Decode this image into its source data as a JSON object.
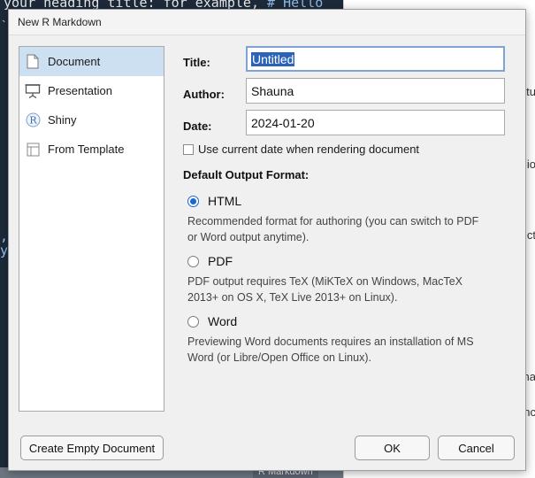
{
  "background": {
    "code_text": "your heading title: for example,",
    "code_comment": "# Hello",
    "frag_comma": ",",
    "frag_y": "y",
    "right_fragments": [
      "tu",
      "io",
      "ct",
      "na",
      "nc"
    ],
    "bottom_tab": "R Markdown"
  },
  "dialog": {
    "title": "New R Markdown",
    "sidebar": {
      "items": [
        {
          "label": "Document",
          "icon": "document-icon"
        },
        {
          "label": "Presentation",
          "icon": "presentation-icon"
        },
        {
          "label": "Shiny",
          "icon": "shiny-icon"
        },
        {
          "label": "From Template",
          "icon": "template-icon"
        }
      ],
      "selected_index": 0
    },
    "form": {
      "title_label": "Title:",
      "title_value": "Untitled",
      "author_label": "Author:",
      "author_value": "Shauna",
      "date_label": "Date:",
      "date_value": "2024-01-20",
      "use_current_date_label": "Use current date when rendering document",
      "use_current_date_checked": false
    },
    "output": {
      "heading": "Default Output Format:",
      "options": [
        {
          "label": "HTML",
          "checked": true,
          "desc1": "Recommended format for authoring (you can switch to PDF",
          "desc2": "or Word output anytime)."
        },
        {
          "label": "PDF",
          "checked": false,
          "desc1": "PDF output requires TeX (MiKTeX on Windows, MacTeX",
          "desc2": "2013+ on OS X, TeX Live 2013+ on Linux)."
        },
        {
          "label": "Word",
          "checked": false,
          "desc1": "Previewing Word documents requires an installation of MS",
          "desc2": "Word (or Libre/Open Office on Linux)."
        }
      ]
    },
    "buttons": {
      "create_empty": "Create Empty Document",
      "ok": "OK",
      "cancel": "Cancel"
    }
  }
}
